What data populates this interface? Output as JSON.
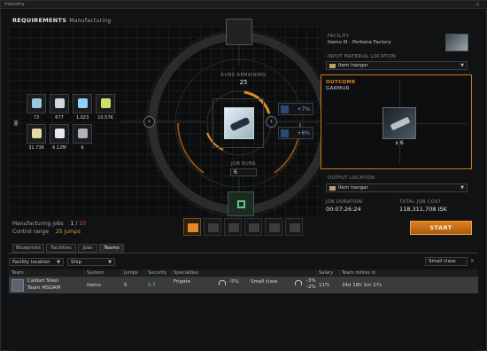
{
  "window": {
    "title": "Industry",
    "controls": "◦ ×"
  },
  "header": {
    "title": "REQUIREMENTS",
    "subtitle": "Manufacturing"
  },
  "runs": {
    "label": "RUNS REMAINING",
    "value": "25"
  },
  "job_runs": {
    "label": "JOB RUNS",
    "value": "6"
  },
  "materials": [
    {
      "qty": "73",
      "color": "#9bc7e0"
    },
    {
      "qty": "677",
      "color": "#d0d8e0"
    },
    {
      "qty": "1,023",
      "color": "#8fd0ff"
    },
    {
      "qty": "10.57K",
      "color": "#d2e06a"
    },
    {
      "qty": "31.73K",
      "color": "#e8d8a8"
    },
    {
      "qty": "6.12M",
      "color": "#e8e8f0"
    },
    {
      "qty": "6",
      "color": "#b0b0b8"
    }
  ],
  "stats": {
    "time_bonus": "+7%",
    "material_bonus": "+6%"
  },
  "status": {
    "manufacturing_label": "Manufacturing jobs",
    "manufacturing_current": "1",
    "manufacturing_sep": "/",
    "manufacturing_max": "10",
    "control_label": "Control range",
    "control_value": "25 Jumps"
  },
  "facility": {
    "label": "FACILITY",
    "value": "Itamo III - Perkone Factory"
  },
  "input_location": {
    "label": "INPUT MATERIAL LOCATION",
    "value": "Item hangar"
  },
  "outcome": {
    "label": "OUTCOME",
    "product": "GARMUR",
    "quantity": "x 6"
  },
  "output_location": {
    "label": "OUTPUT LOCATION",
    "value": "Item hangar"
  },
  "job_duration": {
    "label": "JOB DURATION",
    "value": "00:07:26:24"
  },
  "total_cost": {
    "label": "TOTAL JOB COST",
    "value": "118,311,708 ISK"
  },
  "start_button": "START",
  "tabs": [
    "Blueprints",
    "Facilities",
    "Jobs",
    "Teams"
  ],
  "filters": {
    "location": "Facility location",
    "type": "Ship",
    "search": "Small class"
  },
  "table": {
    "columns": [
      "Team",
      "System",
      "Jumps",
      "Security",
      "Specialties",
      "Salary",
      "Team retires in"
    ],
    "rows": [
      {
        "team_line1": "Caldari Steel",
        "team_line2": "Team MSOAM",
        "system": "Itamo",
        "jumps": "0",
        "security": "0.7",
        "specialty": "Frigate",
        "bonus1": "-5%",
        "specialty2": "Small class",
        "bonus2": "-3%",
        "bonus2b": "-2%",
        "salary": "11%",
        "retires": "34d 18h 1m 27s"
      }
    ]
  },
  "colors": {
    "accent": "#e38b23",
    "security_good": "#5fd35f",
    "bonus_blue": "#6fa9e6",
    "warning": "#d75b3a"
  }
}
